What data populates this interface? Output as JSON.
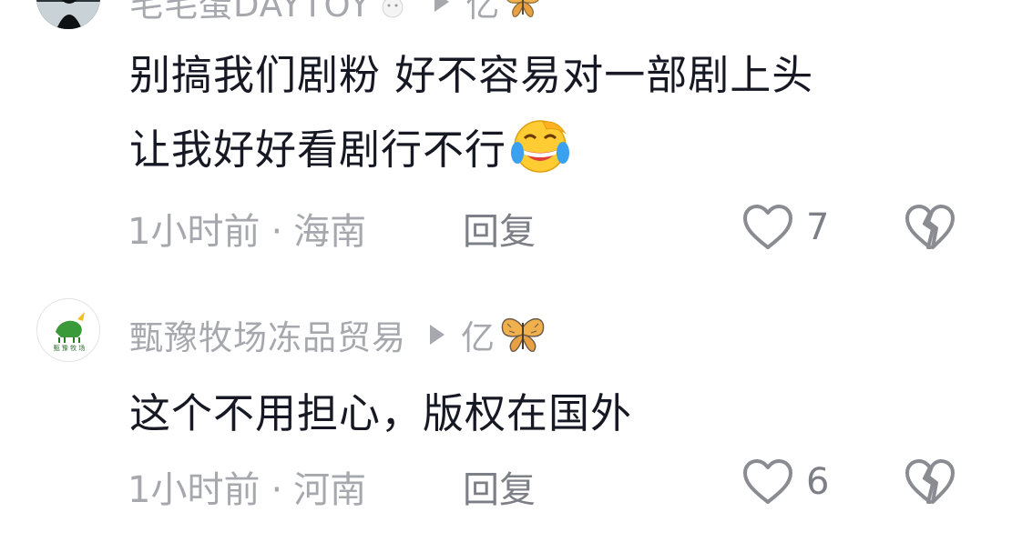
{
  "comments": [
    {
      "username": "毛毛蛋DAYTOY",
      "username_emoji": "rabbit",
      "target": "亿",
      "target_badge": "butterfly",
      "text_lines": [
        "别搞我们剧粉  好不容易对一部剧上头",
        "让我好好看剧行不行"
      ],
      "text_emoji": "laughing-crying",
      "time": "1小时前",
      "separator": "·",
      "location": "海南",
      "reply_label": "回复",
      "like_count": "7"
    },
    {
      "username": "甄豫牧场冻品贸易",
      "avatar_text": "甄 豫 牧 场",
      "target": "亿",
      "target_badge": "butterfly",
      "text_lines": [
        "这个不用担心，版权在国外"
      ],
      "time": "1小时前",
      "separator": "·",
      "location": "河南",
      "reply_label": "回复",
      "like_count": "6"
    }
  ],
  "colors": {
    "primary_text": "#161823",
    "secondary_text": "#a6a8ad",
    "action_text": "#7c7f86",
    "avatar_green": "#3a9a3a",
    "butterfly_orange": "#e8a040"
  }
}
